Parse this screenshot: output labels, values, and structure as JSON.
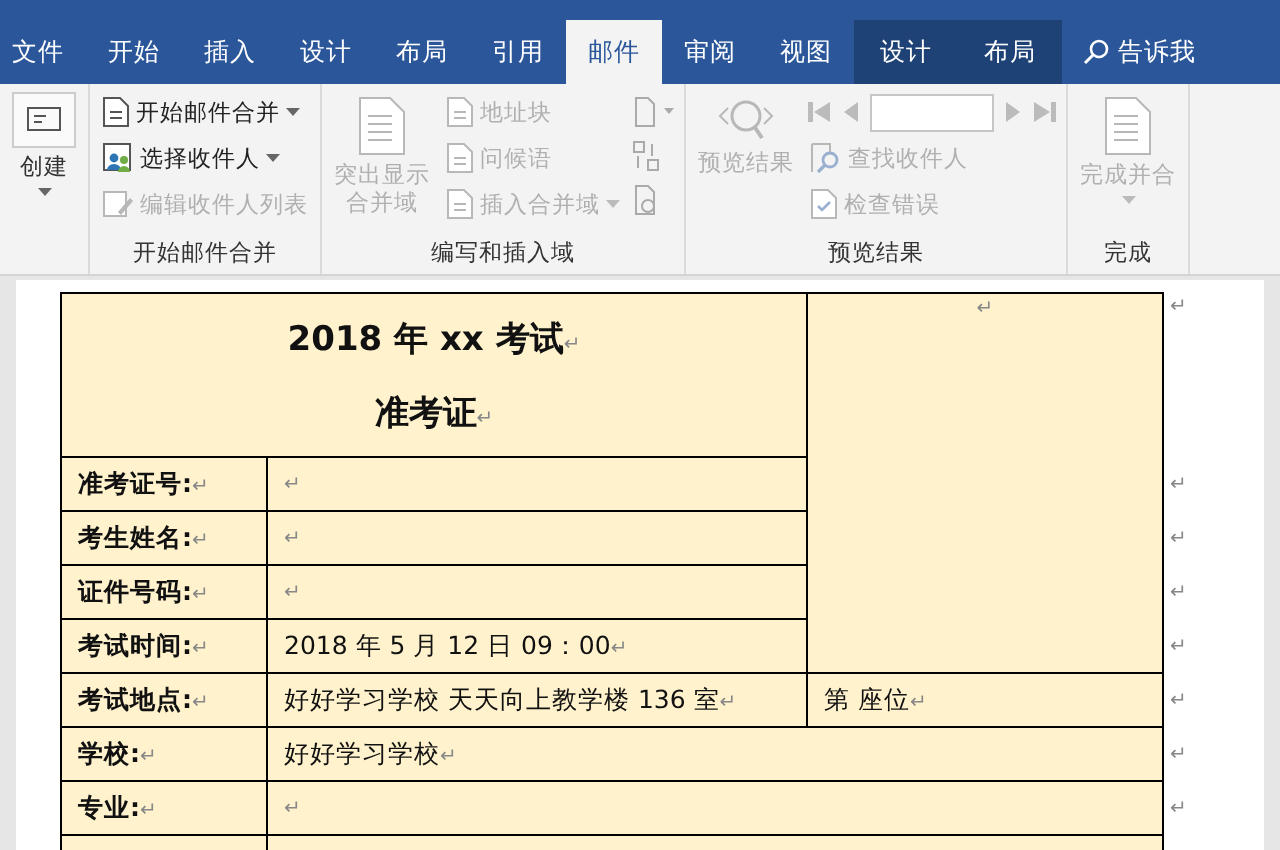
{
  "tabs": [
    {
      "label": "文件",
      "selected": false,
      "contextual": false
    },
    {
      "label": "开始",
      "selected": false,
      "contextual": false
    },
    {
      "label": "插入",
      "selected": false,
      "contextual": false
    },
    {
      "label": "设计",
      "selected": false,
      "contextual": false
    },
    {
      "label": "布局",
      "selected": false,
      "contextual": false
    },
    {
      "label": "引用",
      "selected": false,
      "contextual": false
    },
    {
      "label": "邮件",
      "selected": true,
      "contextual": false
    },
    {
      "label": "审阅",
      "selected": false,
      "contextual": false
    },
    {
      "label": "视图",
      "selected": false,
      "contextual": false
    },
    {
      "label": "设计",
      "selected": false,
      "contextual": true
    },
    {
      "label": "布局",
      "selected": false,
      "contextual": true
    }
  ],
  "tell_me": "告诉我",
  "ribbon_groups": [
    {
      "items": [
        {
          "kind": "large",
          "label": "创建",
          "disabled": false,
          "dropdown": true
        }
      ]
    },
    {
      "label": "开始邮件合并",
      "items": [
        {
          "kind": "small",
          "label": "开始邮件合并",
          "disabled": false,
          "dropdown": true
        },
        {
          "kind": "small",
          "label": "选择收件人",
          "disabled": false,
          "dropdown": true
        },
        {
          "kind": "small",
          "label": "编辑收件人列表",
          "disabled": true,
          "dropdown": false
        }
      ]
    },
    {
      "label": "编写和插入域",
      "items": [
        {
          "kind": "large",
          "label": "突出显示合并域",
          "disabled": true,
          "dropdown": false
        },
        {
          "kind": "small",
          "label": "地址块",
          "disabled": true,
          "dropdown": false
        },
        {
          "kind": "small",
          "label": "问候语",
          "disabled": true,
          "dropdown": false
        },
        {
          "kind": "small",
          "label": "插入合并域",
          "disabled": true,
          "dropdown": true
        },
        {
          "kind": "icons",
          "disabled": true
        }
      ]
    },
    {
      "label": "预览结果",
      "items": [
        {
          "kind": "large",
          "label": "预览结果",
          "disabled": true,
          "dropdown": false
        },
        {
          "kind": "nav",
          "disabled": true
        },
        {
          "kind": "small",
          "label": "查找收件人",
          "disabled": true,
          "dropdown": false
        },
        {
          "kind": "small",
          "label": "检查错误",
          "disabled": true,
          "dropdown": false
        }
      ]
    },
    {
      "label": "完成",
      "items": [
        {
          "kind": "large",
          "label": "完成并合",
          "disabled": true,
          "dropdown": true
        }
      ]
    }
  ],
  "document": {
    "paragraph_mark": "↵",
    "title": "2018 年 xx 考试",
    "subtitle": "准考证",
    "rows": [
      {
        "label": "准考证号:",
        "value": ""
      },
      {
        "label": "考生姓名:",
        "value": ""
      },
      {
        "label": "证件号码:",
        "value": ""
      },
      {
        "label": "考试时间:",
        "value": "2018 年 5 月 12 日  09：00"
      },
      {
        "label": "考试地点:",
        "value": "好好学习学校  天天向上教学楼 136 室",
        "seat": "第      座位"
      },
      {
        "label": "学校:",
        "value": "好好学习学校"
      },
      {
        "label": "专业:",
        "value": ""
      }
    ]
  }
}
